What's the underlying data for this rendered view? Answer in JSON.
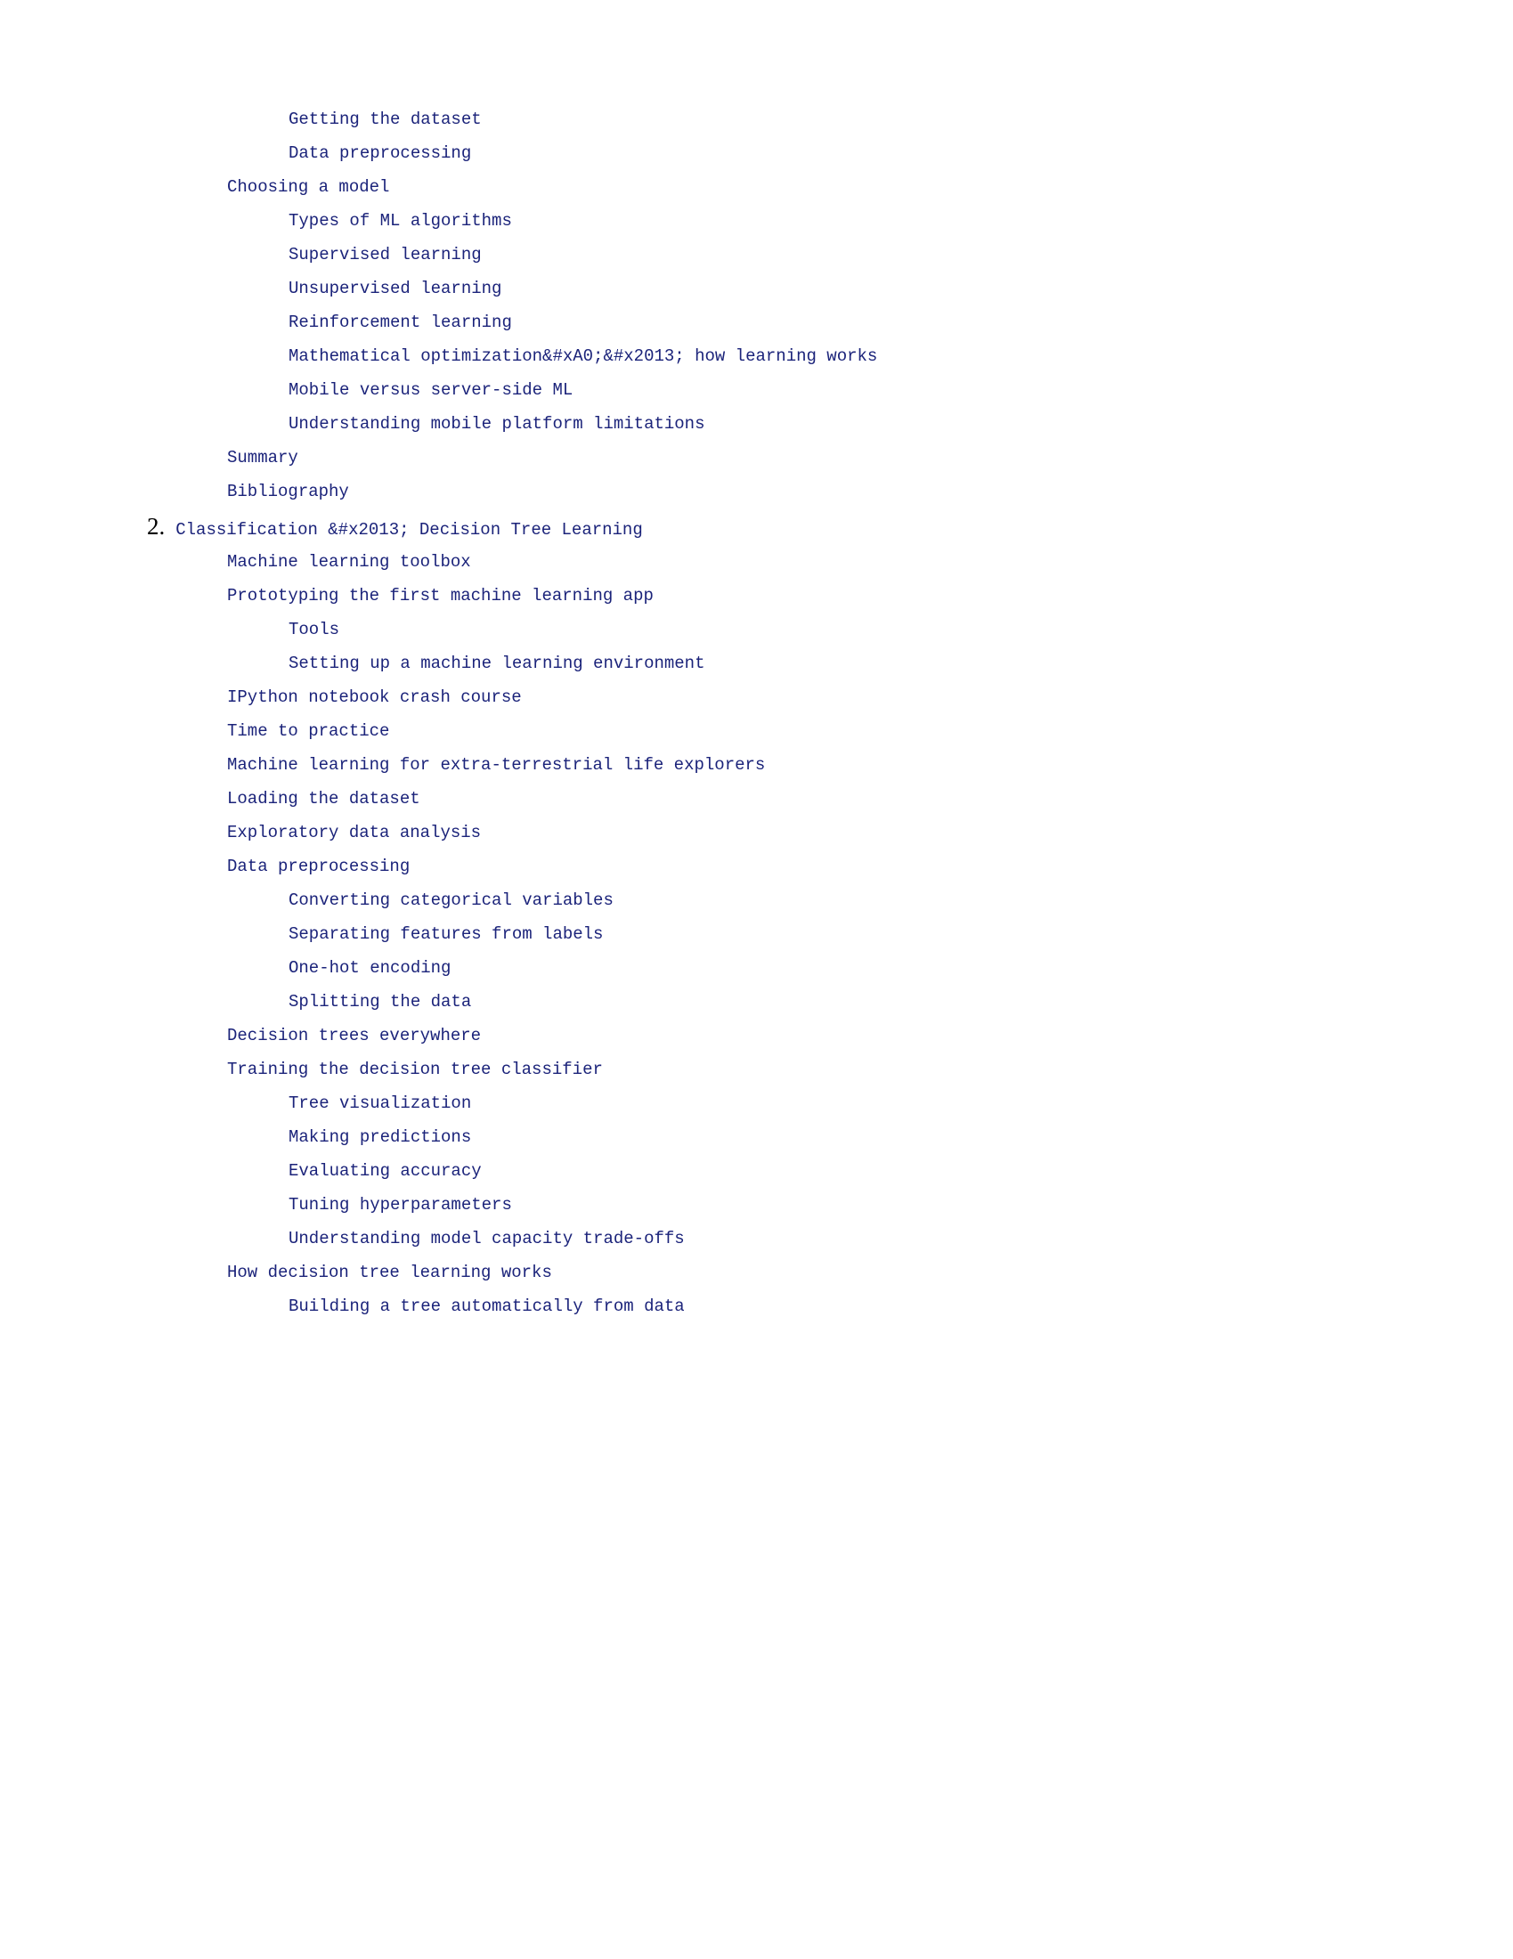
{
  "group_a": [
    {
      "depth": 3,
      "text": "Getting the dataset"
    },
    {
      "depth": 3,
      "text": "Data preprocessing"
    },
    {
      "depth": 2,
      "text": "Choosing a model"
    },
    {
      "depth": 3,
      "text": "Types of ML algorithms"
    },
    {
      "depth": 3,
      "text": "Supervised learning"
    },
    {
      "depth": 3,
      "text": "Unsupervised learning"
    },
    {
      "depth": 3,
      "text": "Reinforcement learning"
    },
    {
      "depth": 3,
      "text": "Mathematical optimization&#xA0;&#x2013; how learning works"
    },
    {
      "depth": 3,
      "text": "Mobile versus server-side ML"
    },
    {
      "depth": 3,
      "text": "Understanding mobile platform limitations"
    },
    {
      "depth": 2,
      "text": "Summary"
    },
    {
      "depth": 2,
      "text": "Bibliography"
    }
  ],
  "chapter": {
    "num": "2.",
    "title": "Classification &#x2013; Decision Tree Learning"
  },
  "group_b": [
    {
      "depth": 2,
      "text": "Machine learning toolbox"
    },
    {
      "depth": 2,
      "text": "Prototyping the first machine learning app"
    },
    {
      "depth": 3,
      "text": "Tools"
    },
    {
      "depth": 3,
      "text": "Setting up a machine learning environment"
    },
    {
      "depth": 2,
      "text": "IPython notebook crash course"
    },
    {
      "depth": 2,
      "text": "Time to practice"
    },
    {
      "depth": 2,
      "text": "Machine learning for extra-terrestrial life explorers"
    },
    {
      "depth": 2,
      "text": "Loading the dataset"
    },
    {
      "depth": 2,
      "text": "Exploratory data analysis"
    },
    {
      "depth": 2,
      "text": "Data preprocessing"
    },
    {
      "depth": 3,
      "text": "Converting categorical variables"
    },
    {
      "depth": 3,
      "text": "Separating features from labels"
    },
    {
      "depth": 3,
      "text": "One-hot encoding"
    },
    {
      "depth": 3,
      "text": "Splitting the data"
    },
    {
      "depth": 2,
      "text": "Decision trees everywhere"
    },
    {
      "depth": 2,
      "text": "Training the decision tree classifier"
    },
    {
      "depth": 3,
      "text": "Tree visualization"
    },
    {
      "depth": 3,
      "text": "Making predictions"
    },
    {
      "depth": 3,
      "text": "Evaluating accuracy"
    },
    {
      "depth": 3,
      "text": "Tuning hyperparameters"
    },
    {
      "depth": 3,
      "text": "Understanding model capacity trade-offs"
    },
    {
      "depth": 2,
      "text": "How decision tree learning works"
    },
    {
      "depth": 3,
      "text": "Building a tree automatically from data"
    }
  ]
}
